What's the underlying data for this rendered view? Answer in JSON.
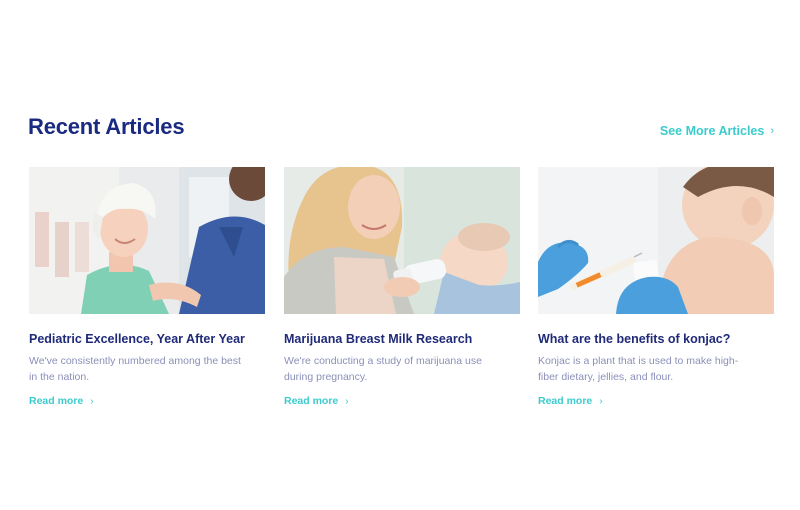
{
  "section": {
    "title": "Recent Articles",
    "see_more_label": "See More Articles",
    "see_more_icon": "chevron-right-icon"
  },
  "articles": [
    {
      "title": "Pediatric Excellence, Year After Year",
      "excerpt": "We've consistently numbered among the best in the nation.",
      "read_more_label": "Read more"
    },
    {
      "title": "Marijuana Breast Milk Research",
      "excerpt": "We're conducting a study of marijuana use during pregnancy.",
      "read_more_label": "Read more"
    },
    {
      "title": "What are the benefits of konjac?",
      "excerpt": "Konjac is a plant that is used to make high-fiber dietary, jellies, and flour.",
      "read_more_label": "Read more"
    }
  ],
  "colors": {
    "heading": "#1a2a80",
    "accent": "#3ccbcd",
    "body_text": "#8a90b8"
  }
}
